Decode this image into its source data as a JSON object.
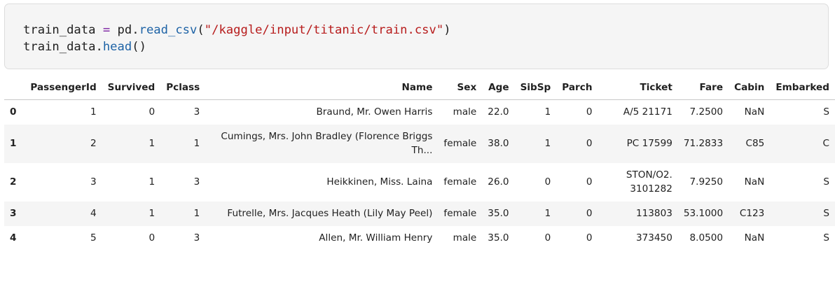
{
  "code_cell": {
    "line1": {
      "var": "train_data ",
      "op": "=",
      "mid": " pd.",
      "fn": "read_csv",
      "open": "(",
      "str": "\"/kaggle/input/titanic/train.csv\"",
      "close": ")"
    },
    "line2": {
      "var": "train_data.",
      "fn": "head",
      "parens": "()"
    }
  },
  "table": {
    "columns": [
      "",
      "PassengerId",
      "Survived",
      "Pclass",
      "Name",
      "Sex",
      "Age",
      "SibSp",
      "Parch",
      "Ticket",
      "Fare",
      "Cabin",
      "Embarked"
    ],
    "rows": [
      {
        "index": "0",
        "PassengerId": "1",
        "Survived": "0",
        "Pclass": "3",
        "Name": "Braund, Mr. Owen Harris",
        "Sex": "male",
        "Age": "22.0",
        "SibSp": "1",
        "Parch": "0",
        "Ticket": "A/5 21171",
        "Fare": "7.2500",
        "Cabin": "NaN",
        "Embarked": "S"
      },
      {
        "index": "1",
        "PassengerId": "2",
        "Survived": "1",
        "Pclass": "1",
        "Name_line1": "Cumings, Mrs. John Bradley (Florence Briggs",
        "Name_line2": "Th...",
        "Sex": "female",
        "Age": "38.0",
        "SibSp": "1",
        "Parch": "0",
        "Ticket": "PC 17599",
        "Fare": "71.2833",
        "Cabin": "C85",
        "Embarked": "C"
      },
      {
        "index": "2",
        "PassengerId": "3",
        "Survived": "1",
        "Pclass": "3",
        "Name": "Heikkinen, Miss. Laina",
        "Sex": "female",
        "Age": "26.0",
        "SibSp": "0",
        "Parch": "0",
        "Ticket_line1": "STON/O2.",
        "Ticket_line2": "3101282",
        "Fare": "7.9250",
        "Cabin": "NaN",
        "Embarked": "S"
      },
      {
        "index": "3",
        "PassengerId": "4",
        "Survived": "1",
        "Pclass": "1",
        "Name": "Futrelle, Mrs. Jacques Heath (Lily May Peel)",
        "Sex": "female",
        "Age": "35.0",
        "SibSp": "1",
        "Parch": "0",
        "Ticket": "113803",
        "Fare": "53.1000",
        "Cabin": "C123",
        "Embarked": "S"
      },
      {
        "index": "4",
        "PassengerId": "5",
        "Survived": "0",
        "Pclass": "3",
        "Name": "Allen, Mr. William Henry",
        "Sex": "male",
        "Age": "35.0",
        "SibSp": "0",
        "Parch": "0",
        "Ticket": "373450",
        "Fare": "8.0500",
        "Cabin": "NaN",
        "Embarked": "S"
      }
    ]
  }
}
